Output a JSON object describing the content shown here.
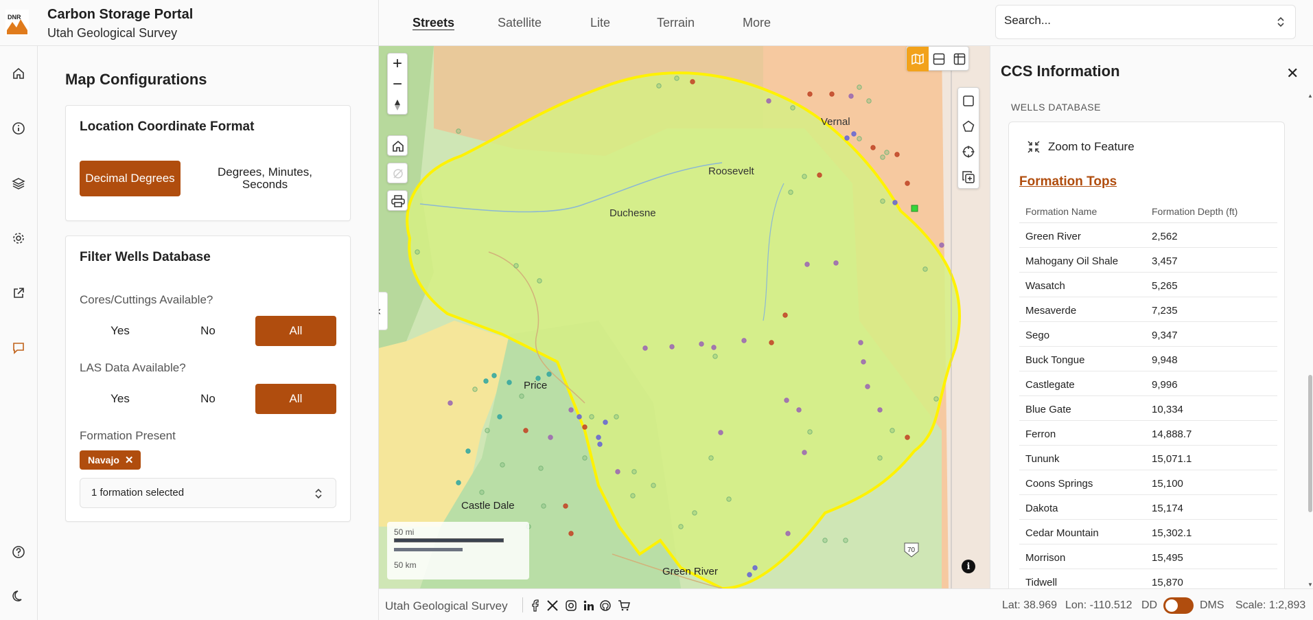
{
  "brand": {
    "title": "Carbon Storage Portal",
    "subtitle": "Utah Geological Survey",
    "logo_text": "DNR"
  },
  "basemaps": [
    {
      "label": "Streets",
      "active": true
    },
    {
      "label": "Satellite",
      "active": false
    },
    {
      "label": "Lite",
      "active": false
    },
    {
      "label": "Terrain",
      "active": false
    },
    {
      "label": "More",
      "active": false
    }
  ],
  "search": {
    "placeholder": "Search..."
  },
  "rail": [
    "home-icon",
    "info-icon",
    "layers-icon",
    "gear-icon",
    "external-link-icon",
    "chat-icon",
    "help-icon",
    "moon-icon"
  ],
  "left_panel": {
    "title": "Map Configurations",
    "coord_format": {
      "title": "Location Coordinate Format",
      "options": [
        "Decimal Degrees",
        "Degrees, Minutes, Seconds"
      ],
      "selected": "Decimal Degrees"
    },
    "filter": {
      "title": "Filter Wells Database",
      "cores_label": "Cores/Cuttings Available?",
      "cores_options": [
        "Yes",
        "No",
        "All"
      ],
      "cores_selected": "All",
      "las_label": "LAS Data Available?",
      "las_options": [
        "Yes",
        "No",
        "All"
      ],
      "las_selected": "All",
      "formation_label": "Formation Present",
      "formation_chip": "Navajo",
      "formation_select": "1 formation selected"
    }
  },
  "map": {
    "collapse": "«",
    "places": [
      "Vernal",
      "Roosevelt",
      "Duchesne",
      "Price",
      "Castle Dale",
      "Green River"
    ],
    "highway": "70",
    "scale": {
      "mi": "50 mi",
      "km": "50 km"
    },
    "info": "i",
    "colors": {
      "highlight": "#fff200",
      "fill": "#d4f07a",
      "accent": "#f2a21b"
    }
  },
  "right_panel": {
    "title": "CCS Information",
    "section": "WELLS DATABASE",
    "zoom_label": "Zoom to Feature",
    "formation_tops_title": "Formation Tops",
    "table_headers": [
      "Formation Name",
      "Formation Depth (ft)"
    ],
    "rows": [
      [
        "Green River",
        "2,562"
      ],
      [
        "Mahogany Oil Shale",
        "3,457"
      ],
      [
        "Wasatch",
        "5,265"
      ],
      [
        "Mesaverde",
        "7,235"
      ],
      [
        "Sego",
        "9,347"
      ],
      [
        "Buck Tongue",
        "9,948"
      ],
      [
        "Castlegate",
        "9,996"
      ],
      [
        "Blue Gate",
        "10,334"
      ],
      [
        "Ferron",
        "14,888.7"
      ],
      [
        "Tununk",
        "15,071.1"
      ],
      [
        "Coons Springs",
        "15,100"
      ],
      [
        "Dakota",
        "15,174"
      ],
      [
        "Cedar Mountain",
        "15,302.1"
      ],
      [
        "Morrison",
        "15,495"
      ],
      [
        "Tidwell",
        "15,870"
      ]
    ]
  },
  "footer": {
    "org": "Utah Geological Survey",
    "lat": "Lat: 38.969",
    "lon": "Lon: -110.512",
    "dd": "DD",
    "dms": "DMS",
    "scale": "Scale: 1:2,893"
  }
}
